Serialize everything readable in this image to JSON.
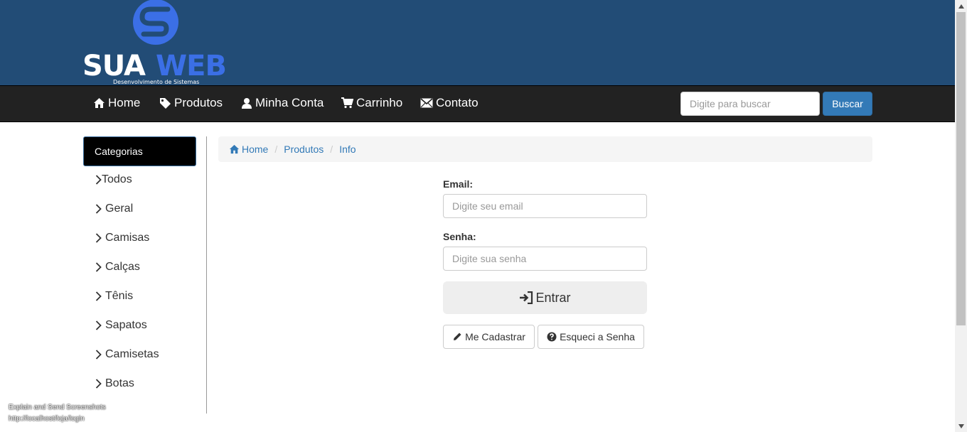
{
  "brand": {
    "name_part1": "SUA",
    "name_part2": "WEB",
    "tagline": "Desenvolvimento de Sistemas",
    "colors": {
      "header": "#224c76",
      "logo_blue": "#3b6fe6",
      "logo_white": "#ffffff"
    }
  },
  "nav": {
    "items": [
      {
        "label": "Home",
        "icon": "home-icon"
      },
      {
        "label": "Produtos",
        "icon": "tag-icon"
      },
      {
        "label": "Minha Conta",
        "icon": "user-icon"
      },
      {
        "label": "Carrinho",
        "icon": "cart-icon"
      },
      {
        "label": "Contato",
        "icon": "envelope-icon"
      }
    ],
    "search_placeholder": "Digite para buscar",
    "search_button": "Buscar"
  },
  "sidebar": {
    "title": "Categorias",
    "items": [
      "Todos",
      "Geral",
      "Camisas",
      "Calças",
      "Tênis",
      "Sapatos",
      "Camisetas",
      "Botas"
    ]
  },
  "breadcrumb": [
    "Home",
    "Produtos",
    "Info"
  ],
  "login": {
    "email_label": "Email:",
    "email_placeholder": "Digite seu email",
    "password_label": "Senha:",
    "password_placeholder": "Digite sua senha",
    "submit_label": "Entrar",
    "register_label": "Me Cadastrar",
    "forgot_label": "Esqueci a Senha"
  },
  "overlay": {
    "line1": "Explain and Send Screenshots",
    "line2": "http://localhost/loja/login"
  }
}
